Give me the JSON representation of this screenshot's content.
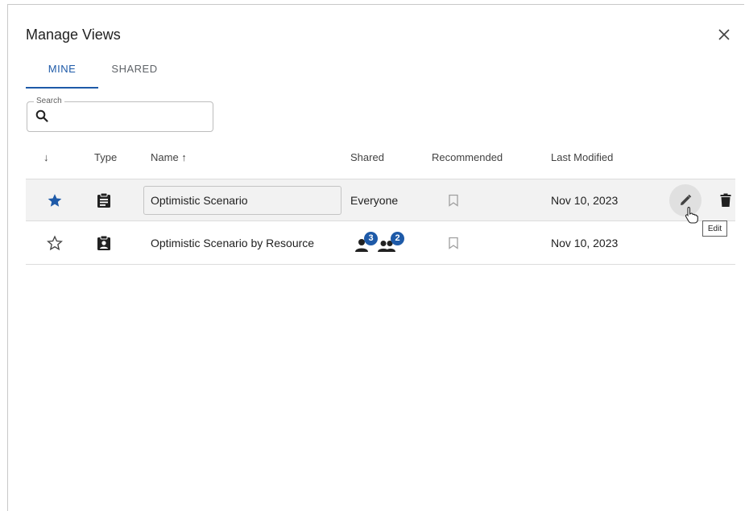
{
  "dialog": {
    "title": "Manage Views"
  },
  "tabs": [
    {
      "label": "MINE",
      "active": true
    },
    {
      "label": "SHARED",
      "active": false
    }
  ],
  "search": {
    "legend": "Search",
    "value": "",
    "placeholder": ""
  },
  "table": {
    "columns": {
      "sort": "↓",
      "type": "Type",
      "name": "Name ↑",
      "shared": "Shared",
      "recommended": "Recommended",
      "last_modified": "Last Modified"
    },
    "rows": [
      {
        "favorite": true,
        "type_icon": "clipboard-icon",
        "name": "Optimistic Scenario",
        "shared": "Everyone",
        "recommended": false,
        "last_modified": "Nov 10, 2023"
      },
      {
        "favorite": false,
        "type_icon": "clipboard-account-icon",
        "name": "Optimistic Scenario by Resource",
        "shared_users_count": "3",
        "shared_groups_count": "2",
        "recommended": false,
        "last_modified": "Nov 10, 2023"
      }
    ]
  },
  "tooltip": {
    "text": "Edit"
  },
  "colors": {
    "accent": "#1e5aa8",
    "row_highlight": "#f2f2f2"
  }
}
